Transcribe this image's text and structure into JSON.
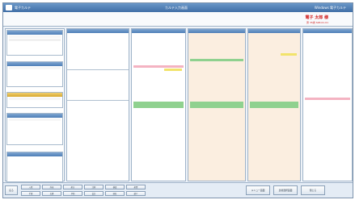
{
  "window": {
    "title": "電子カルテ",
    "center_title": "カルテ入力画面",
    "right_label": "Windows 電子カルテ"
  },
  "patient": {
    "name": "電子 太郎 様",
    "info": "男 35歳 S48.01.01"
  },
  "toolbar": {
    "buttons": [
      "入院",
      "外来",
      "処方",
      "注射",
      "検査",
      "処置",
      "手術",
      "文書",
      "予約",
      "会計",
      "病名",
      "紹介"
    ],
    "right_buttons": [
      "メニュー画面",
      "患者選択画面",
      "閉じる"
    ],
    "left_button": "戻る"
  },
  "colors": {
    "title_bar": "#4a78b0",
    "panel_header": "#6b95c6",
    "pink": "#f4b3c2",
    "green": "#8fd18f",
    "yellow": "#f2e36b",
    "orange": "#f5d9b8",
    "patient_name": "#d02020"
  }
}
